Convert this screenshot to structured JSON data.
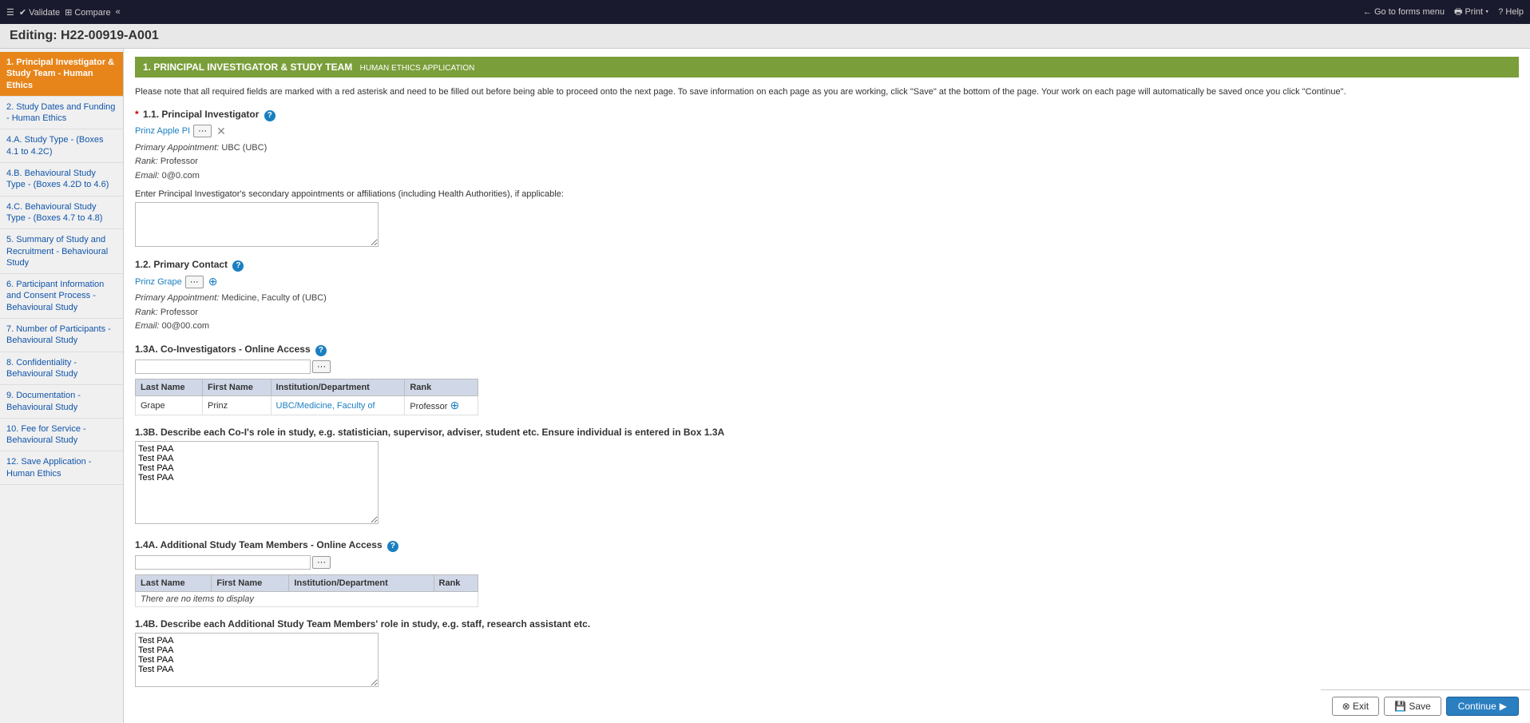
{
  "topbar": {
    "menu_items": [
      "≡",
      "Validate",
      "Compare",
      "«"
    ],
    "right_items": [
      "Go to forms menu",
      "Print ▾",
      "Help"
    ]
  },
  "title": "Editing: H22-00919-A001",
  "sidebar": {
    "items": [
      {
        "id": "s1",
        "label": "1. Principal Investigator & Study Team - Human Ethics",
        "active": true
      },
      {
        "id": "s2",
        "label": "2. Study Dates and Funding - Human Ethics",
        "active": false
      },
      {
        "id": "s4a",
        "label": "4.A. Study Type - (Boxes 4.1 to 4.2C)",
        "active": false
      },
      {
        "id": "s4b",
        "label": "4.B. Behavioural Study Type - (Boxes 4.2D to 4.6)",
        "active": false
      },
      {
        "id": "s4c",
        "label": "4.C. Behavioural Study Type - (Boxes 4.7 to 4.8)",
        "active": false
      },
      {
        "id": "s5",
        "label": "5. Summary of Study and Recruitment - Behavioural Study",
        "active": false
      },
      {
        "id": "s6",
        "label": "6. Participant Information and Consent Process - Behavioural Study",
        "active": false
      },
      {
        "id": "s7",
        "label": "7. Number of Participants - Behavioural Study",
        "active": false
      },
      {
        "id": "s8",
        "label": "8. Confidentiality - Behavioural Study",
        "active": false
      },
      {
        "id": "s9",
        "label": "9. Documentation - Behavioural Study",
        "active": false
      },
      {
        "id": "s10",
        "label": "10. Fee for Service - Behavioural Study",
        "active": false
      },
      {
        "id": "s12",
        "label": "12. Save Application - Human Ethics",
        "active": false
      }
    ]
  },
  "section": {
    "title": "1. PRINCIPAL INVESTIGATOR & STUDY TEAM",
    "subtitle": "HUMAN ETHICS APPLICATION"
  },
  "instructions": "Please note that all required fields are marked with a red asterisk and need to be filled out before being able to proceed onto the next page. To save information on each page as you are working, click \"Save\" at the bottom of the page. Your work on each page will automatically be saved once you click \"Continue\".",
  "fields": {
    "pi": {
      "label": "1.1. Principal Investigator",
      "required": true,
      "name": "Prinz Apple PI",
      "primary_appointment_label": "Primary Appointment:",
      "primary_appointment": "UBC (UBC)",
      "rank_label": "Rank:",
      "rank": "Professor",
      "email_label": "Email:",
      "email": "0@0.com",
      "secondary_label": "Enter Principal Investigator's secondary appointments or affiliations (including Health Authorities), if applicable:",
      "secondary_placeholder": ""
    },
    "primary_contact": {
      "label": "1.2. Primary Contact",
      "required": false,
      "name": "Prinz Grape",
      "primary_appointment_label": "Primary Appointment:",
      "primary_appointment": "Medicine, Faculty of (UBC)",
      "rank_label": "Rank:",
      "rank": "Professor",
      "email_label": "Email:",
      "email": "00@00.com"
    },
    "co_investigators": {
      "label": "1.3A. Co-Investigators - Online Access",
      "columns": [
        "Last Name",
        "First Name",
        "Institution/Department",
        "Rank"
      ],
      "rows": [
        {
          "last_name": "Grape",
          "first_name": "Prinz",
          "institution": "UBC/Medicine, Faculty of",
          "rank": "Professor"
        }
      ]
    },
    "co_investigators_roles": {
      "label": "1.3B. Describe each Co-I's role in study, e.g. statistician, supervisor, adviser, student etc. Ensure individual is entered in Box 1.3A",
      "value": "Test PAA\nTest PAA\nTest PAA\nTest PAA"
    },
    "additional_members": {
      "label": "1.4A. Additional Study Team Members - Online Access",
      "columns": [
        "Last Name",
        "First Name",
        "Institution/Department",
        "Rank"
      ],
      "rows": [],
      "no_items_text": "There are no items to display"
    },
    "additional_members_roles": {
      "label": "1.4B. Describe each Additional Study Team Members' role in study, e.g. staff, research assistant etc.",
      "value": "Test PAA\nTest PAA\nTest PAA\nTest PAA"
    }
  },
  "footer": {
    "exit_label": "Exit",
    "save_label": "Save",
    "continue_label": "Continue"
  }
}
